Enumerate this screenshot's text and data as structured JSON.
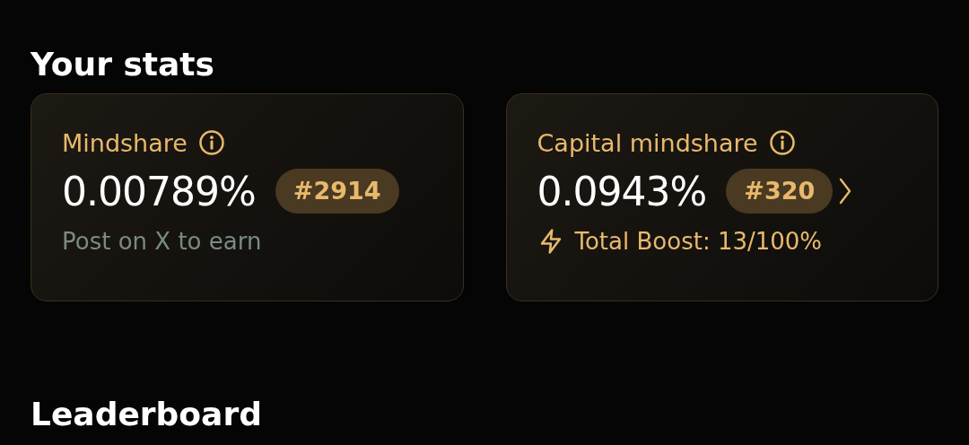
{
  "section_title": "Your stats",
  "cards": [
    {
      "title": "Mindshare",
      "value": "0.00789%",
      "rank": "#2914",
      "link": false,
      "footer": {
        "kind": "hint",
        "text": "Post on X to earn"
      }
    },
    {
      "title": "Capital mindshare",
      "value": "0.0943%",
      "rank": "#320",
      "link": true,
      "footer": {
        "kind": "boost",
        "text": "Total Boost: 13/100%"
      }
    }
  ],
  "next_section_title": "Leaderboard"
}
